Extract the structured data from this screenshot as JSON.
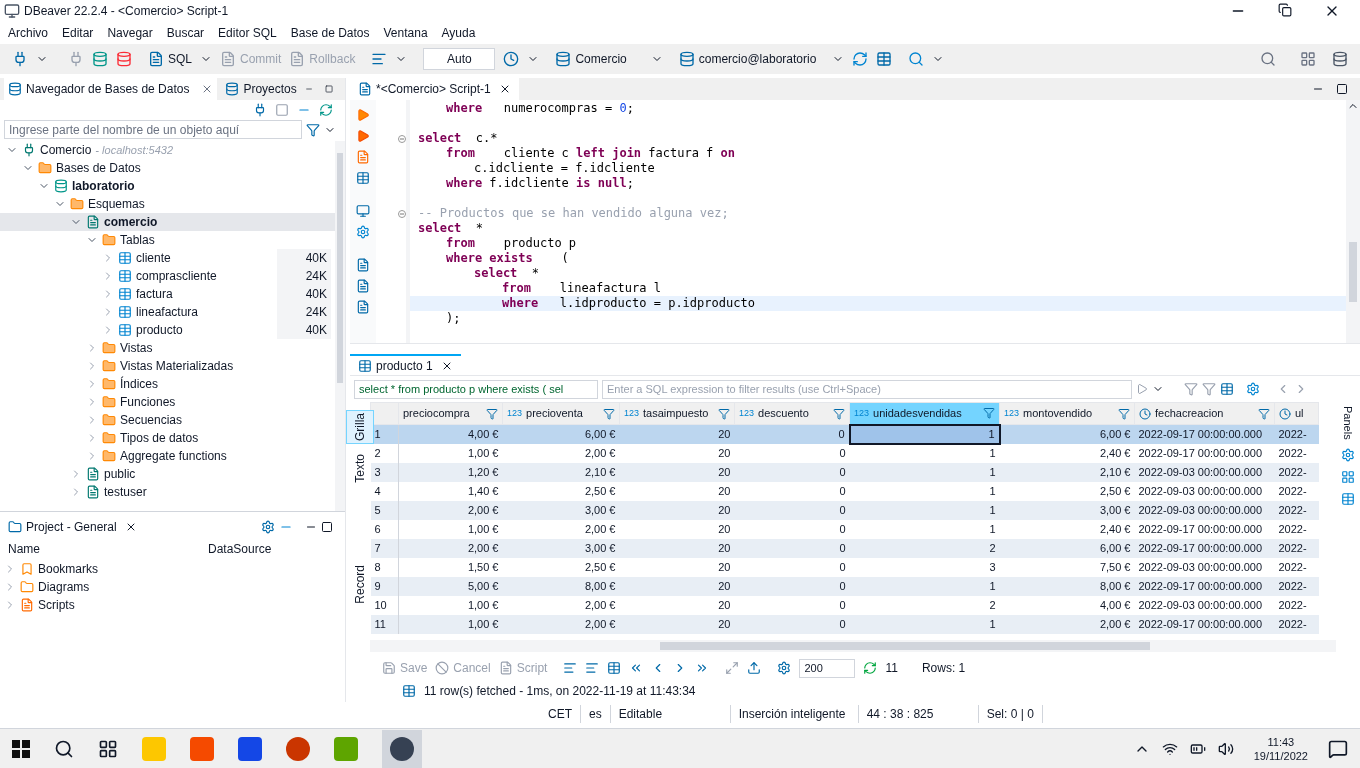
{
  "window": {
    "title": "DBeaver 22.2.4 - <Comercio> Script-1"
  },
  "menu": [
    "Archivo",
    "Editar",
    "Navegar",
    "Buscar",
    "Editor SQL",
    "Base de Datos",
    "Ventana",
    "Ayuda"
  ],
  "toolbar": {
    "sql_button": {
      "label": "SQL",
      "disabled": false
    },
    "commit_button": {
      "label": "Commit",
      "disabled": true
    },
    "rollback_button": {
      "label": "Rollback",
      "disabled": true
    },
    "mode_field": {
      "value": "Auto"
    },
    "datasource": {
      "label": "Comercio"
    },
    "schema": {
      "label": "comercio@laboratorio"
    }
  },
  "navigator": {
    "tabs": [
      {
        "label": "Navegador de Bases de Datos",
        "selected": true,
        "closable": true
      },
      {
        "label": "Proyectos",
        "selected": false,
        "closable": false
      }
    ],
    "search": {
      "placeholder": "Ingrese parte del nombre de un objeto aquí"
    },
    "tree": [
      {
        "kind": "connection",
        "label": "Comercio",
        "note": "- localhost:5432",
        "bold": false,
        "selected": false,
        "expanded": true,
        "children": [
          {
            "kind": "folder",
            "label": "Bases de Datos",
            "bold": false,
            "selected": false,
            "expanded": true,
            "children": [
              {
                "kind": "database",
                "label": "laboratorio",
                "bold": true,
                "selected": false,
                "expanded": true,
                "children": [
                  {
                    "kind": "folder",
                    "label": "Esquemas",
                    "bold": false,
                    "selected": false,
                    "expanded": true,
                    "children": [
                      {
                        "kind": "schema",
                        "label": "comercio",
                        "bold": true,
                        "selected": true,
                        "expanded": true,
                        "children": [
                          {
                            "kind": "folder",
                            "label": "Tablas",
                            "bold": false,
                            "selected": false,
                            "expanded": true,
                            "children": [
                              {
                                "kind": "table",
                                "label": "cliente",
                                "size": "40K",
                                "bold": false,
                                "selected": false,
                                "expanded": false
                              },
                              {
                                "kind": "table",
                                "label": "comprascliente",
                                "size": "24K",
                                "bold": false,
                                "selected": false,
                                "expanded": false
                              },
                              {
                                "kind": "table",
                                "label": "factura",
                                "size": "40K",
                                "bold": false,
                                "selected": false,
                                "expanded": false
                              },
                              {
                                "kind": "table",
                                "label": "lineafactura",
                                "size": "24K",
                                "bold": false,
                                "selected": false,
                                "expanded": false
                              },
                              {
                                "kind": "table",
                                "label": "producto",
                                "size": "40K",
                                "bold": false,
                                "selected": false,
                                "expanded": false
                              }
                            ]
                          },
                          {
                            "kind": "folder",
                            "label": "Vistas",
                            "bold": false,
                            "selected": false,
                            "expanded": false
                          },
                          {
                            "kind": "folder",
                            "label": "Vistas Materializadas",
                            "bold": false,
                            "selected": false,
                            "expanded": false
                          },
                          {
                            "kind": "folder",
                            "label": "Índices",
                            "bold": false,
                            "selected": false,
                            "expanded": false
                          },
                          {
                            "kind": "folder",
                            "label": "Funciones",
                            "bold": false,
                            "selected": false,
                            "expanded": false
                          },
                          {
                            "kind": "folder",
                            "label": "Secuencias",
                            "bold": false,
                            "selected": false,
                            "expanded": false
                          },
                          {
                            "kind": "folder",
                            "label": "Tipos de datos",
                            "bold": false,
                            "selected": false,
                            "expanded": false
                          },
                          {
                            "kind": "folder",
                            "label": "Aggregate functions",
                            "bold": false,
                            "selected": false,
                            "expanded": false
                          }
                        ]
                      },
                      {
                        "kind": "schema",
                        "label": "public",
                        "bold": false,
                        "selected": false,
                        "expanded": false
                      },
                      {
                        "kind": "schema",
                        "label": "testuser",
                        "bold": false,
                        "selected": false,
                        "expanded": false
                      }
                    ]
                  }
                ]
              }
            ]
          }
        ]
      }
    ]
  },
  "project": {
    "title": "Project - General",
    "columns": [
      "Name",
      "DataSource"
    ],
    "items": [
      {
        "kind": "bookmarks",
        "label": "Bookmarks"
      },
      {
        "kind": "diagrams",
        "label": "Diagrams"
      },
      {
        "kind": "scripts",
        "label": "Scripts"
      }
    ]
  },
  "editor": {
    "tab": {
      "label": "*<Comercio> Script-1"
    },
    "lines": [
      {
        "children": [
          {
            "current": false,
            "segments": [
              {
                "kind": "kw",
                "text": "where"
              },
              {
                "kind": "plain",
                "text": "   numerocompras = "
              },
              {
                "kind": "num",
                "text": "0"
              },
              {
                "kind": "plain",
                "text": ";"
              }
            ]
          }
        ]
      },
      {
        "current": false,
        "fold": true,
        "spaced": true,
        "segments": [
          {
            "kind": "kw",
            "text": "select"
          },
          {
            "kind": "plain",
            "text": "  c.*"
          }
        ],
        "children": [
          {
            "current": false,
            "segments": [
              {
                "kind": "kw",
                "text": "from"
              },
              {
                "kind": "plain",
                "text": "    cliente c "
              },
              {
                "kind": "kw",
                "text": "left join"
              },
              {
                "kind": "plain",
                "text": " factura f "
              },
              {
                "kind": "kw",
                "text": "on"
              }
            ],
            "children": [
              {
                "current": false,
                "segments": [
                  {
                    "kind": "plain",
                    "text": "c.idcliente = f.idcliente"
                  }
                ]
              }
            ]
          },
          {
            "current": false,
            "segments": [
              {
                "kind": "kw",
                "text": "where"
              },
              {
                "kind": "plain",
                "text": " f.idcliente "
              },
              {
                "kind": "kw",
                "text": "is null"
              },
              {
                "kind": "plain",
                "text": ";"
              }
            ]
          }
        ]
      },
      {
        "current": false,
        "fold": true,
        "spaced": true,
        "segments": [
          {
            "kind": "comment",
            "text": "-- Productos que se han vendido alguna vez;"
          }
        ]
      },
      {
        "current": false,
        "segments": [
          {
            "kind": "kw",
            "text": "select"
          },
          {
            "kind": "plain",
            "text": "  *"
          }
        ],
        "children": [
          {
            "current": false,
            "segments": [
              {
                "kind": "kw",
                "text": "from"
              },
              {
                "kind": "plain",
                "text": "    producto p"
              }
            ]
          },
          {
            "current": false,
            "segments": [
              {
                "kind": "kw",
                "text": "where exists"
              },
              {
                "kind": "plain",
                "text": "    ("
              }
            ],
            "children": [
              {
                "current": false,
                "segments": [
                  {
                    "kind": "kw",
                    "text": "select"
                  },
                  {
                    "kind": "plain",
                    "text": "  *"
                  }
                ],
                "children": [
                  {
                    "current": false,
                    "segments": [
                      {
                        "kind": "kw",
                        "text": "from"
                      },
                      {
                        "kind": "plain",
                        "text": "    lineafactura l"
                      }
                    ]
                  },
                  {
                    "current": true,
                    "segments": [
                      {
                        "kind": "kw",
                        "text": "where"
                      },
                      {
                        "kind": "plain",
                        "text": "   l.idproducto = p.idproducto"
                      }
                    ]
                  }
                ]
              }
            ]
          },
          {
            "current": false,
            "segments": [
              {
                "kind": "plain",
                "text": ");"
              }
            ]
          }
        ]
      }
    ]
  },
  "results": {
    "tab": {
      "label": "producto 1"
    },
    "filter": {
      "value": "select * from producto p where exists ( sel",
      "placeholder": "Enter a SQL expression to filter results (use Ctrl+Space)"
    },
    "side_tabs": [
      {
        "label": "Grilla",
        "selected": true
      },
      {
        "label": "Texto",
        "selected": false
      },
      {
        "label": "Record",
        "selected": false
      }
    ],
    "panels_tab": {
      "label": "Panels"
    },
    "columns": [
      {
        "name": "preciocompra",
        "kind": "number",
        "selected": false
      },
      {
        "name": "precioventa",
        "kind": "number",
        "type_label": "123",
        "selected": false
      },
      {
        "name": "tasaimpuesto",
        "kind": "number",
        "type_label": "123",
        "selected": false
      },
      {
        "name": "descuento",
        "kind": "number",
        "type_label": "123",
        "selected": false
      },
      {
        "name": "unidadesvendidas",
        "kind": "number",
        "type_label": "123",
        "selected": true
      },
      {
        "name": "montovendido",
        "kind": "number",
        "type_label": "123",
        "selected": false
      },
      {
        "name": "fechacreacion",
        "kind": "date",
        "selected": false
      },
      {
        "name": "ul",
        "kind": "date",
        "selected": false
      }
    ],
    "rows": [
      {
        "num": "1",
        "selected": true,
        "cells": [
          "4,00 €",
          "6,00 €",
          "20",
          "0",
          "1",
          "6,00 €",
          "2022-09-17 00:00:00.000",
          "2022-"
        ]
      },
      {
        "num": "2",
        "selected": false,
        "cells": [
          "1,00 €",
          "2,00 €",
          "20",
          "0",
          "1",
          "2,40 €",
          "2022-09-17 00:00:00.000",
          "2022-"
        ]
      },
      {
        "num": "3",
        "selected": false,
        "cells": [
          "1,20 €",
          "2,10 €",
          "20",
          "0",
          "1",
          "2,10 €",
          "2022-09-03 00:00:00.000",
          "2022-"
        ]
      },
      {
        "num": "4",
        "selected": false,
        "cells": [
          "1,40 €",
          "2,50 €",
          "20",
          "0",
          "1",
          "2,50 €",
          "2022-09-03 00:00:00.000",
          "2022-"
        ]
      },
      {
        "num": "5",
        "selected": false,
        "cells": [
          "2,00 €",
          "3,00 €",
          "20",
          "0",
          "1",
          "3,00 €",
          "2022-09-03 00:00:00.000",
          "2022-"
        ]
      },
      {
        "num": "6",
        "selected": false,
        "cells": [
          "1,00 €",
          "2,00 €",
          "20",
          "0",
          "1",
          "2,40 €",
          "2022-09-17 00:00:00.000",
          "2022-"
        ]
      },
      {
        "num": "7",
        "selected": false,
        "cells": [
          "2,00 €",
          "3,00 €",
          "20",
          "0",
          "2",
          "6,00 €",
          "2022-09-17 00:00:00.000",
          "2022-"
        ]
      },
      {
        "num": "8",
        "selected": false,
        "cells": [
          "1,50 €",
          "2,50 €",
          "20",
          "0",
          "3",
          "7,50 €",
          "2022-09-03 00:00:00.000",
          "2022-"
        ]
      },
      {
        "num": "9",
        "selected": false,
        "cells": [
          "5,00 €",
          "8,00 €",
          "20",
          "0",
          "1",
          "8,00 €",
          "2022-09-17 00:00:00.000",
          "2022-"
        ]
      },
      {
        "num": "10",
        "selected": false,
        "cells": [
          "1,00 €",
          "2,00 €",
          "20",
          "0",
          "2",
          "4,00 €",
          "2022-09-03 00:00:00.000",
          "2022-"
        ]
      },
      {
        "num": "11",
        "selected": false,
        "cells": [
          "1,00 €",
          "2,00 €",
          "20",
          "0",
          "1",
          "2,00 €",
          "2022-09-17 00:00:00.000",
          "2022-"
        ]
      }
    ],
    "bottom_toolbar": {
      "buttons": [
        {
          "label": "Save",
          "disabled": true
        },
        {
          "label": "Cancel",
          "disabled": true
        },
        {
          "label": "Script",
          "disabled": true
        }
      ],
      "fetch_size": "200",
      "row_count": "11",
      "rows_label": "Rows: 1"
    },
    "message": "11 row(s) fetched - 1ms, on 2022-11-19 at 11:43:34"
  },
  "status_bar": [
    "CET",
    "es",
    "Editable",
    "Inserción inteligente",
    "44 : 38 : 825",
    "Sel: 0 | 0"
  ],
  "taskbar": {
    "time": "11:43",
    "date": "19/11/2022"
  }
}
